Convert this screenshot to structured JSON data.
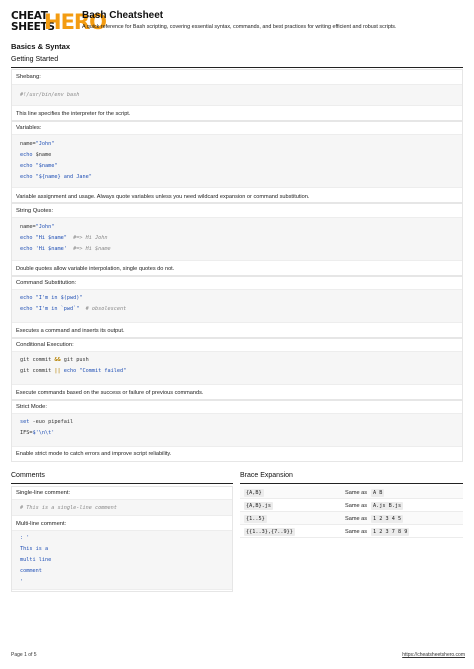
{
  "header": {
    "logo_top": "CHEAT",
    "logo_bottom": "SHEETS",
    "logo_hero": "HERO",
    "title": "Bash Cheatsheet",
    "subtitle": "A quick reference for Bash scripting, covering essential syntax, commands, and best practices for writing efficient and robust scripts."
  },
  "basics": {
    "title": "Basics & Syntax",
    "getting_started": "Getting Started",
    "blocks": [
      {
        "label": "Shebang:",
        "code": [
          "#!/usr/bin/env bash"
        ],
        "desc": "This line specifies the interpreter for the script."
      },
      {
        "label": "Variables:",
        "code": [
          "name=\"John\"",
          "echo $name",
          "echo \"$name\"",
          "echo \"${name} and Jane\""
        ],
        "desc": "Variable assignment and usage. Always quote variables unless you need wildcard expansion or command substitution."
      },
      {
        "label": "String Quotes:",
        "code": [
          "name=\"John\"",
          "echo \"Hi $name\"  #=> Hi John",
          "echo 'Hi $name'  #=> Hi $name"
        ],
        "desc": "Double quotes allow variable interpolation, single quotes do not."
      },
      {
        "label": "Command Substitution:",
        "code": [
          "echo \"I'm in $(pwd)\"",
          "echo \"I'm in `pwd`\"  # obsolescent"
        ],
        "desc": "Executes a command and inserts its output."
      },
      {
        "label": "Conditional Execution:",
        "code": [
          "git commit && git push",
          "git commit || echo \"Commit failed\""
        ],
        "desc": "Execute commands based on the success or failure of previous commands."
      },
      {
        "label": "Strict Mode:",
        "code": [
          "set -euo pipefail",
          "IFS=$'\\n\\t'"
        ],
        "desc": "Enable strict mode to catch errors and improve script reliability."
      }
    ]
  },
  "comments": {
    "title": "Comments",
    "single_label": "Single-line comment:",
    "single_code": "# This is a single-line comment",
    "multi_label": "Multi-line comment:",
    "multi_code": [
      ": '",
      "This is a",
      "multi line",
      "comment",
      "'"
    ]
  },
  "brace": {
    "title": "Brace Expansion",
    "same_as": "Same as",
    "rows": [
      {
        "expr": "{A,B}",
        "result": "A B"
      },
      {
        "expr": "{A,B}.js",
        "result": "A.js B.js"
      },
      {
        "expr": "{1..5}",
        "result": "1 2 3 4 5"
      },
      {
        "expr": "{{1..3},{7..9}}",
        "result": "1 2 3 7 8 9"
      }
    ]
  },
  "footer": {
    "page": "Page 1 of 5",
    "url": "https://cheatsheetshero.com"
  }
}
